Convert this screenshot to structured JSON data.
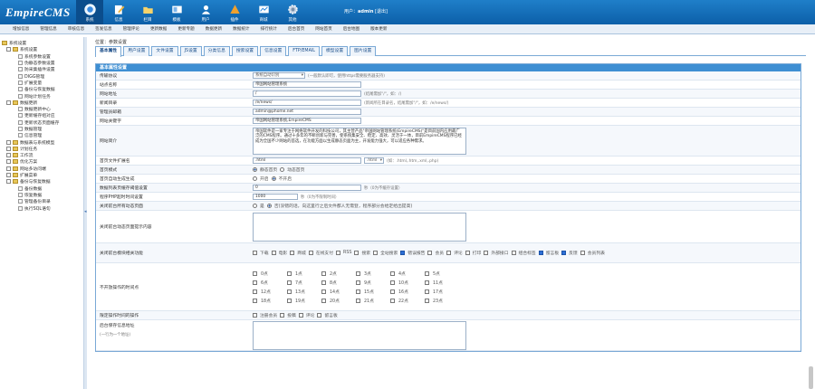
{
  "app": {
    "logo": "EmpireCMS",
    "user_label": "用户：",
    "user": "admin",
    "logout": "[退出]"
  },
  "topnav": [
    {
      "label": "系统",
      "icon": "home-icon",
      "active": true
    },
    {
      "label": "信息",
      "icon": "edit-icon"
    },
    {
      "label": "栏目",
      "icon": "folder-icon"
    },
    {
      "label": "模板",
      "icon": "template-icon"
    },
    {
      "label": "用户",
      "icon": "user-icon"
    },
    {
      "label": "插件",
      "icon": "plugin-icon"
    },
    {
      "label": "商城",
      "icon": "shop-icon"
    },
    {
      "label": "其他",
      "icon": "gear-icon"
    }
  ],
  "subnav": [
    "增加信息",
    "管理信息",
    "审核信息",
    "签发信息",
    "管理评论",
    "更新数据",
    "更新专题",
    "数据更新",
    "数据统计",
    "排行统计",
    "后台首页",
    "网站首页",
    "后台地图",
    "版本更新"
  ],
  "sidebar": [
    "系统设置",
    "系统设置",
    "系统参数设置",
    "伪静态参数设置",
    "防采集插件设置",
    "DIGG管理",
    "扩展变量",
    "备份与恢复数据",
    "网站计划任务",
    "数据更新",
    "数据更新中心",
    "更新缓存组对应",
    "更新状态页面缓存",
    "数据管理",
    "信息管理",
    "数据表与系统模型",
    "计划任务",
    "工作流",
    "优化方案",
    "网站多访问端",
    "扩展菜单",
    "备份与恢复数据",
    "备份数据",
    "恢复数据",
    "管理备份目录",
    "执行SQL语句"
  ],
  "location": "位置：参数设置",
  "tabs": [
    "基本属性",
    "用户设置",
    "文件设置",
    "JS设置",
    "分类信息",
    "搜索设置",
    "信息设置",
    "FTP/EMAIL",
    "模型设置",
    "图片设置"
  ],
  "panel_title": "基本属性设置",
  "fields": {
    "protocol": {
      "label": "传输协议",
      "value": "系统自动识别",
      "hint": "(一般默认即可，使用https需要服务器支持)"
    },
    "site_name": {
      "label": "站点名称",
      "value": "帝国网站管理系统"
    },
    "site_url": {
      "label": "网站地址",
      "value": "/",
      "hint": "(结尾需加\"/\"，如：/)"
    },
    "news_dir": {
      "label": "新闻目录",
      "value": "/e/news/",
      "hint": "(新闻所在目录名，结尾需加\"/\"，如：/e/news/)"
    },
    "admin_email": {
      "label": "管理员邮箱",
      "value": "admin@phome.net"
    },
    "keywords": {
      "label": "网站关键字",
      "value": "帝国网站管理系统,EmpireCMS"
    },
    "intro": {
      "label": "网站简介",
      "value": "帝国软件是一家专注于网络软件开发的科技公司，其主营产品\"帝国网站管理系统(EmpireCMS)\"是目前国内应用最广泛的CMS程序。通过十多年的不断创新与完善，使系统集安全、稳定、高效、灵活于一体，目前EmpireCMS程序已经成为全国不少网站的首选，在功能方面以生成静态页面为主，开发能力强大，可以适应各种需求。"
    },
    "index_ext": {
      "label": "首页文件扩展名",
      "value": ".html",
      "sel": ".html",
      "hint": "(如：.html,.htm,.xml,.php)"
    },
    "index_mode": {
      "label": "首页模式",
      "opt1": "静态首页",
      "opt2": "动态首页"
    },
    "dir_depth": {
      "label": "首页自动生成生成",
      "opt1": "开启",
      "opt2": "不开启"
    },
    "pwd_len": {
      "label": "数据列表页缓存阈值设置",
      "value": "0",
      "hint": "秒（0为不缓存设置）"
    },
    "php_time": {
      "label": "程序PHP超时时间设置",
      "value": "1000",
      "hint": "秒（0为不限制时间）"
    },
    "close_site": {
      "label": "关闭前台所有动态页面",
      "opt1": "是",
      "opt2": "否(没错的话，向这里行之后文件都人无需登，程序部分会给定给出提高)"
    },
    "close_msg": {
      "label": "关闭前台动态页面提示内容",
      "value": ""
    },
    "close_modules": {
      "label": "关闭前台模块相关功能",
      "items": [
        {
          "t": "下载",
          "on": false
        },
        {
          "t": "电影",
          "on": false
        },
        {
          "t": "商城",
          "on": false
        },
        {
          "t": "在线支付",
          "on": false
        },
        {
          "t": "RSS",
          "on": false
        },
        {
          "t": "搜索",
          "on": false
        },
        {
          "t": "全站搜索",
          "on": false
        },
        {
          "t": "错误报告",
          "on": true
        },
        {
          "t": "会员",
          "on": false
        },
        {
          "t": "评论",
          "on": false
        },
        {
          "t": "打印",
          "on": false
        },
        {
          "t": "外部接口",
          "on": false
        },
        {
          "t": "组合标签",
          "on": false
        },
        {
          "t": "留言板",
          "on": true
        },
        {
          "t": "反馈",
          "on": true
        },
        {
          "t": "会员列表",
          "on": false
        }
      ]
    },
    "hours": {
      "label": "不开放操作的时间点",
      "items": [
        "0点",
        "1点",
        "2点",
        "3点",
        "4点",
        "5点",
        "6点",
        "7点",
        "8点",
        "9点",
        "10点",
        "11点",
        "12点",
        "13点",
        "14点",
        "15点",
        "16点",
        "17点",
        "18点",
        "19点",
        "20点",
        "21点",
        "22点",
        "23点"
      ]
    },
    "hour_ops": {
      "label": "限定操作时间的操作",
      "items": [
        "注册会员",
        "投稿",
        "评论",
        "留言板"
      ]
    },
    "proxy": {
      "label": "后台保存信息地址",
      "sub": "(一行为一个地址)"
    }
  }
}
